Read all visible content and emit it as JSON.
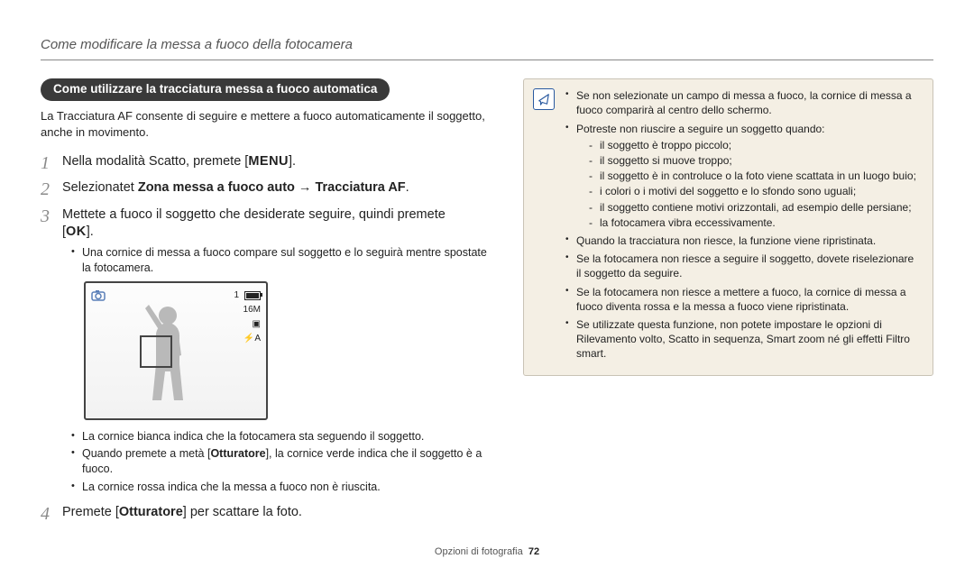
{
  "header": {
    "section_title": "Come modificare la messa a fuoco della fotocamera"
  },
  "left": {
    "pill": "Come utilizzare la tracciatura messa a fuoco automatica",
    "intro": "La Tracciatura AF consente di seguire e mettere a fuoco automaticamente il soggetto, anche in movimento.",
    "steps": {
      "s1_prefix": "Nella modalità Scatto, premete [",
      "s1_menu": "MENU",
      "s1_suffix": "].",
      "s2_prefix": "Selezionatet ",
      "s2_bold1": "Zona messa a fuoco auto",
      "s2_arrow": " → ",
      "s2_bold2": "Tracciatura AF",
      "s2_suffix": ".",
      "s3_line1": "Mettete a fuoco il soggetto che desiderate seguire, quindi premete",
      "s3_ok_open": "[",
      "s3_ok": "OK",
      "s3_ok_close": "].",
      "s3_b1": "Una cornice di messa a fuoco compare sul soggetto e lo seguirà mentre spostate la fotocamera.",
      "s3_b2": "La cornice bianca indica che la fotocamera sta seguendo il soggetto.",
      "s3_b3_prefix": "Quando premete a metà [",
      "s3_b3_bold": "Otturatore",
      "s3_b3_suffix": "], la cornice verde indica che il soggetto è a fuoco.",
      "s3_b4": "La cornice rossa indica che la messa a fuoco non è riuscita.",
      "s4_prefix": "Premete [",
      "s4_bold": "Otturatore",
      "s4_suffix": "] per scattare la foto."
    },
    "lcd": {
      "osd_count": "1",
      "osd_res": "16M",
      "osd_meter": "☐",
      "osd_flash": "⚡A"
    }
  },
  "note": {
    "b1": "Se non selezionate un campo di messa a fuoco, la cornice di messa a fuoco comparirà al centro dello schermo.",
    "b2": "Potreste non riuscire a seguire un soggetto quando:",
    "d1": "il soggetto è troppo piccolo;",
    "d2": "il soggetto si muove troppo;",
    "d3": "il soggetto è in controluce o la foto viene scattata in un luogo buio;",
    "d4": "i colori o i motivi del soggetto e lo sfondo sono uguali;",
    "d5": "il soggetto contiene motivi orizzontali, ad esempio delle persiane;",
    "d6": "la fotocamera vibra eccessivamente.",
    "b3": "Quando la tracciatura non riesce, la funzione viene ripristinata.",
    "b4": "Se la fotocamera non riesce a seguire il soggetto, dovete riselezionare il soggetto da seguire.",
    "b5": "Se la fotocamera non riesce a mettere a fuoco, la cornice di messa a fuoco diventa rossa e la messa a fuoco viene ripristinata.",
    "b6": "Se utilizzate questa funzione, non potete impostare le opzioni di Rilevamento volto, Scatto in sequenza, Smart zoom né gli effetti Filtro smart."
  },
  "footer": {
    "text": "Opzioni di fotografia",
    "page": "72"
  }
}
